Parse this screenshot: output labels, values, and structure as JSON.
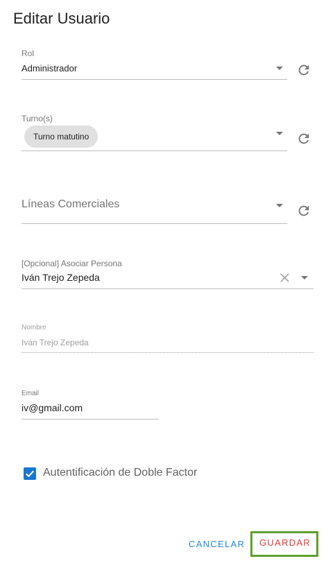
{
  "dialog": {
    "title": "Editar Usuario"
  },
  "rol": {
    "label": "Rol",
    "value": "Administrador"
  },
  "turnos": {
    "label": "Turno(s)",
    "chips": [
      "Turno matutino"
    ]
  },
  "lineas": {
    "placeholder": "Líneas Comerciales"
  },
  "persona": {
    "label": "[Opcional] Asociar Persona",
    "value": "Iván Trejo Zepeda"
  },
  "nombre": {
    "label": "Nombre",
    "value": "Iván Trejo Zepeda"
  },
  "email": {
    "label": "Email",
    "value": "iv@gmail.com"
  },
  "doble_factor": {
    "label": "Autentificación de Doble Factor",
    "checked": true
  },
  "actions": {
    "cancel": "CANCELAR",
    "save": "GUARDAR"
  },
  "colors": {
    "accent": "#1976d2",
    "save": "#e53935",
    "highlight": "#5fa02c"
  },
  "icons": {
    "refresh": "refresh-icon",
    "clear": "close-icon",
    "dropdown": "caret-down-icon",
    "check": "check-icon"
  }
}
